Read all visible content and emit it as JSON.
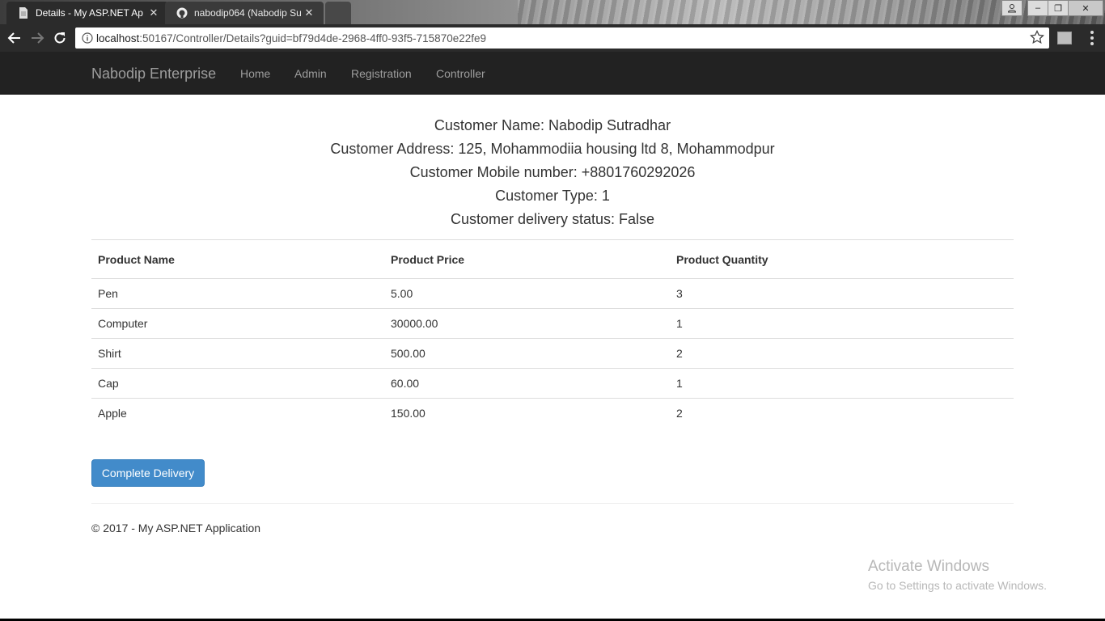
{
  "browser": {
    "tabs": [
      {
        "label": "Details - My ASP.NET Ap",
        "icon": "document-icon"
      },
      {
        "label": "nabodip064 (Nabodip Su",
        "icon": "github-icon"
      }
    ],
    "close_glyph": "✕",
    "url_host": "localhost",
    "url_rest": ":50167/Controller/Details?guid=bf79d4de-2968-4ff0-93f5-715870e22fe9",
    "window_buttons": {
      "minimize": "‒",
      "maximize": "❐",
      "close": "✕"
    }
  },
  "nav": {
    "brand": "Nabodip Enterprise",
    "links": [
      "Home",
      "Admin",
      "Registration",
      "Controller"
    ]
  },
  "customer": {
    "name": "Customer Name: Nabodip Sutradhar",
    "address": "Customer Address: 125, Mohammodiia housing ltd 8, Mohammodpur",
    "mobile": "Customer Mobile number: +8801760292026",
    "type": "Customer Type: 1",
    "delivery": "Customer delivery status: False"
  },
  "table": {
    "headers": [
      "Product Name",
      "Product Price",
      "Product Quantity"
    ],
    "rows": [
      [
        "Pen",
        "5.00",
        "3"
      ],
      [
        "Computer",
        "30000.00",
        "1"
      ],
      [
        "Shirt",
        "500.00",
        "2"
      ],
      [
        "Cap",
        "60.00",
        "1"
      ],
      [
        "Apple",
        "150.00",
        "2"
      ]
    ]
  },
  "actions": {
    "complete_delivery": "Complete Delivery"
  },
  "footer": {
    "text": "© 2017 - My ASP.NET Application"
  },
  "watermark": {
    "title": "Activate Windows",
    "subtitle": "Go to Settings to activate Windows."
  },
  "colors": {
    "primary": "#428bca",
    "navbar": "#222222",
    "nav_text": "#9d9d9d"
  }
}
